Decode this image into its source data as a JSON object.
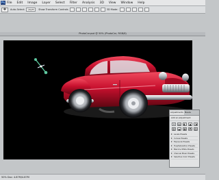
{
  "menubar": {
    "logo": "Ps",
    "items": [
      "File",
      "Edit",
      "Image",
      "Layer",
      "Select",
      "Filter",
      "Analysis",
      "3D",
      "View",
      "Window",
      "Help"
    ]
  },
  "options": {
    "tool_icon": "✥",
    "label_one": "Auto-Select:",
    "select_one": "Layer",
    "label_two": "Show Transform Controls",
    "label_three": "3D Mode:"
  },
  "document": {
    "title": "PhotoCar.psd @ 50% (PhotoCar, RGB/8)"
  },
  "panel": {
    "tabs": [
      "Adjustments",
      "Masks"
    ],
    "subtitle": "Add an adjustment",
    "icons": [
      "☀",
      "▤",
      "◐",
      "▲",
      "◑",
      "▥",
      "◒",
      "▦",
      "◓",
      "▧"
    ],
    "items": [
      "Levels Presets",
      "Curves Presets",
      "Exposure Presets",
      "Hue/Saturation Presets",
      "Black & White Presets",
      "Channel Mixer Presets",
      "Selective Color Presets"
    ]
  },
  "status": {
    "text": "50%  Doc: 4.87M/4.87M"
  },
  "colors": {
    "canvas_background": "#000000",
    "car_body": "#c8102e",
    "transform_widget": "#5ec8a0"
  }
}
